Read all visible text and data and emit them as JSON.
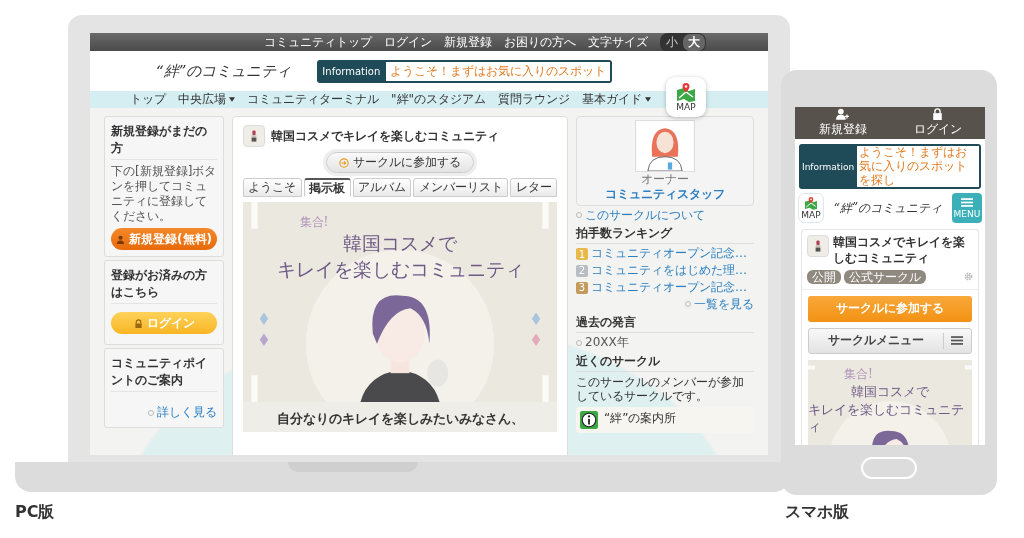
{
  "pc": {
    "label": "PC版",
    "top_links": [
      "コミュニティトップ",
      "ログイン",
      "新規登録",
      "お困りの方へ"
    ],
    "font_size": {
      "label": "文字サイズ",
      "options": [
        {
          "label": "小",
          "selected": false
        },
        {
          "label": "大",
          "selected": true
        }
      ]
    },
    "logo": "“絆”のコミュニティ",
    "information": {
      "label": "Information",
      "text": "ようこそ！まずはお気に入りのスポット"
    },
    "map_button": "MAP",
    "nav": [
      {
        "label": "トップ",
        "dropdown": false
      },
      {
        "label": "中央広場",
        "dropdown": true
      },
      {
        "label": "コミュニティターミナル",
        "dropdown": false
      },
      {
        "label": "\"絆\"のスタジアム",
        "dropdown": false
      },
      {
        "label": "質問ラウンジ",
        "dropdown": false
      },
      {
        "label": "基本ガイド",
        "dropdown": true
      }
    ],
    "sidebar_left": [
      {
        "kind": "register",
        "title": "新規登録がまだの方",
        "text": "下の[新規登録]ボタンを押してコミュニティに登録してください。",
        "button": "新規登録(無料)"
      },
      {
        "kind": "login",
        "title": "登録がお済みの方はこちら",
        "button": "ログイン"
      },
      {
        "kind": "points",
        "title": "コミュニティポイントのご案内",
        "link": "詳しく見る"
      }
    ],
    "circle": {
      "title": "韓国コスメでキレイを楽しむコミュニティ",
      "join_button": "サークルに参加する",
      "tabs": [
        {
          "label": "ようこそ",
          "selected": false
        },
        {
          "label": "掲示板",
          "selected": true
        },
        {
          "label": "アルバム",
          "selected": false
        },
        {
          "label": "メンバーリスト",
          "selected": false
        },
        {
          "label": "レター",
          "selected": false
        }
      ],
      "banner": {
        "tag": "集合!",
        "lines": [
          "韓国コスメで",
          "キレイを楽しむコミュニティ"
        ]
      },
      "intro": "自分なりのキレイを楽しみたいみなさん、"
    },
    "sidebar_right": {
      "owner_role": "オーナー",
      "owner_name": "コミュニティスタッフ",
      "about_link": "このサークルについて",
      "ranking": {
        "title": "拍手数ランキング",
        "items": [
          {
            "rank": "1",
            "title": "コミュニティオープン記念…",
            "color": "#e8b84a"
          },
          {
            "rank": "2",
            "title": "コミュニティをはじめた理…",
            "color": "#b8bcc4"
          },
          {
            "rank": "3",
            "title": "コミュニティオープン記念…",
            "color": "#c49a5c"
          }
        ],
        "more": "一覧を見る"
      },
      "past": {
        "title": "過去の発言",
        "items": [
          "20XX年"
        ]
      },
      "nearby": {
        "title": "近くのサークル",
        "text": "このサークルのメンバーが参加しているサークルです。",
        "items": [
          {
            "name": "“絆”の案内所"
          }
        ]
      }
    }
  },
  "phone": {
    "label": "スマホ版",
    "top_buttons": [
      {
        "kind": "register",
        "label": "新規登録"
      },
      {
        "kind": "login",
        "label": "ログイン"
      }
    ],
    "information": {
      "label": "Information",
      "text": "ようこそ！まずはお気に入りのスポットを探し"
    },
    "map_button": "MAP",
    "logo": "“絆”のコミュニティ",
    "menu_button": "MENU",
    "circle": {
      "title": "韓国コスメでキレイを楽しむコミュニティ",
      "tags": [
        "公開",
        "公式サークル"
      ],
      "join_button": "サークルに参加する",
      "menu_button": "サークルメニュー",
      "banner": {
        "tag": "集合!",
        "lines": [
          "韓国コスメで",
          "キレイを楽しむコミュニティ"
        ]
      }
    }
  }
}
